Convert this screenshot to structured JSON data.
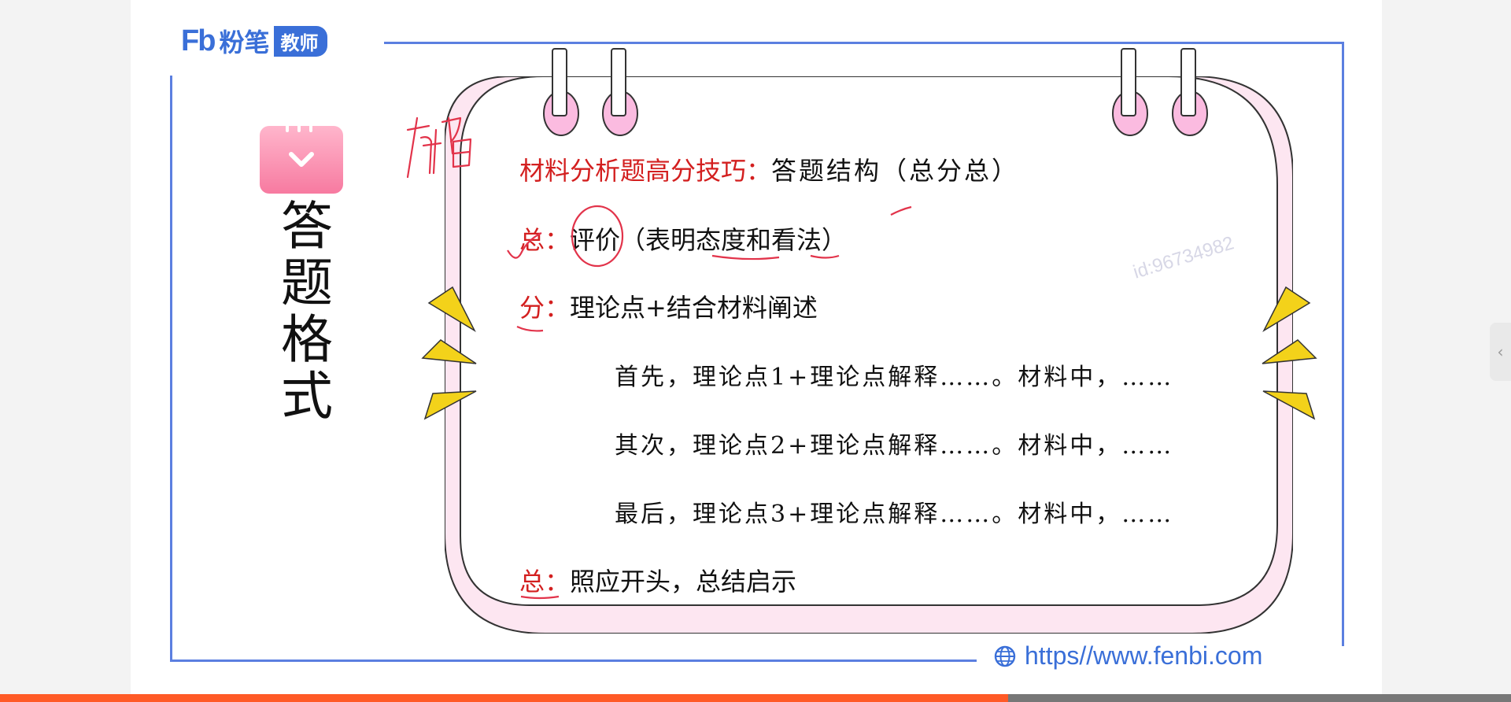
{
  "brand": {
    "logo_mark": "Fb",
    "name": "粉笔",
    "badge": "教师"
  },
  "sidebar_title": [
    "答",
    "题",
    "格",
    "式"
  ],
  "card": {
    "heading_red": "材料分析题高分技巧：",
    "heading_rest": "答题结构（总分总）",
    "line1_label": "总：",
    "line1_text": "评价（表明态度和看法）",
    "line2_label": "分：",
    "line2_text": "理论点+结合材料阐述",
    "item1": "首先，理论点1+理论点解释……。材料中，……",
    "item2": "其次，理论点2+理论点解释……。材料中，……",
    "item3": "最后，理论点3+理论点解释……。材料中，……",
    "line3_label": "总：",
    "line3_text": "照应开头，总结启示"
  },
  "handwriting": "布局",
  "watermark": "id:96734982",
  "footer_url": "https//www.fenbi.com",
  "side_handle_glyph": "‹",
  "progress": {
    "fraction": 0.667
  },
  "colors": {
    "brand_blue": "#3a6fd8",
    "accent_red": "#d31f1f",
    "card_pink": "#fde6f1",
    "ring_pink": "#f7a8d2",
    "triangle_yellow": "#f3d21a",
    "progress_orange": "#ff5a26"
  },
  "icons": {
    "calendar": "calendar-check-icon",
    "globe": "globe-icon"
  }
}
